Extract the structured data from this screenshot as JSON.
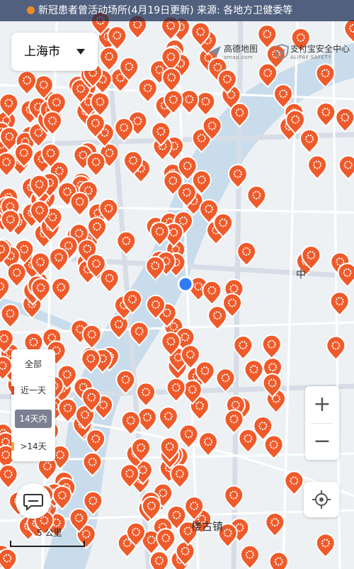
{
  "banner": {
    "text": "新冠患者曾活动场所(4月19日更新) 来源: 各地方卫健委等",
    "dot_color": "#f08a24"
  },
  "city_selector": {
    "label": "上海市",
    "icon": "caret-down-icon"
  },
  "brands": {
    "amap_name": "高德地图",
    "amap_domain": "amap.com",
    "alipay_name": "支付宝安全中心",
    "alipay_sub": "ALIPAY SAFETY"
  },
  "place_labels": [
    {
      "text": "中"
    },
    {
      "text": "楼古镇"
    }
  ],
  "legend": {
    "items": [
      {
        "label": "全部",
        "active": false,
        "color": ""
      },
      {
        "label": "近一天",
        "active": false,
        "color": "#e8452c"
      },
      {
        "label": "14天内",
        "active": true,
        "color": "#7a7f92"
      },
      {
        "label": ">14天",
        "active": false,
        "color": "#f4a340"
      }
    ]
  },
  "controls": {
    "zoom_in": "+",
    "zoom_out": "−",
    "zoom_in_icon": "plus-icon",
    "zoom_out_icon": "minus-icon",
    "locate_icon": "locate-icon",
    "chat_icon": "chat-icon"
  },
  "scale_bar": {
    "label": "5 公里"
  },
  "colors": {
    "marker": "#ef5a2a",
    "marker_border": "#ffffff",
    "river": "#c9dcec",
    "road": "#ffffff",
    "road_major": "#d7dde6",
    "user_location": "#2f7cf6",
    "land": "#eef1f4"
  }
}
